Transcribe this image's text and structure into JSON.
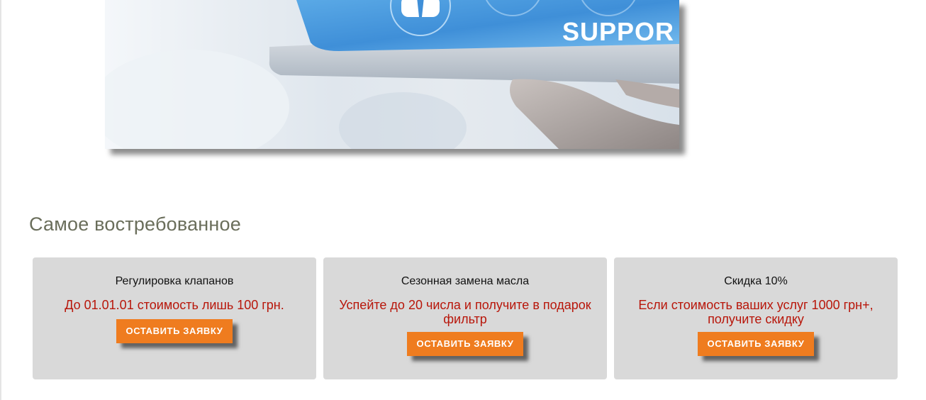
{
  "banner": {
    "image_text": "SUPPOR",
    "description_icon": "support-person-icon"
  },
  "section": {
    "title": "Самое востребованное"
  },
  "cards": [
    {
      "title": "Регулировка клапанов",
      "text": "До 01.01.01 стоимость лишь 100 грн.",
      "button_label": "ОСТАВИТЬ ЗАЯВКУ"
    },
    {
      "title": "Сезонная замена масла",
      "text": "Успейте до 20 числа и получите в подарок фильтр",
      "button_label": "ОСТАВИТЬ ЗАЯВКУ"
    },
    {
      "title": "Скидка 10%",
      "text": "Если стоимость ваших услуг 1000 грн+, получите скидку",
      "button_label": "ОСТАВИТЬ ЗАЯВКУ"
    }
  ],
  "colors": {
    "accent_button": "#ef7c1f",
    "promo_text": "#b8160a",
    "card_background": "#d9d9d9",
    "section_title": "#6a6e5b"
  }
}
